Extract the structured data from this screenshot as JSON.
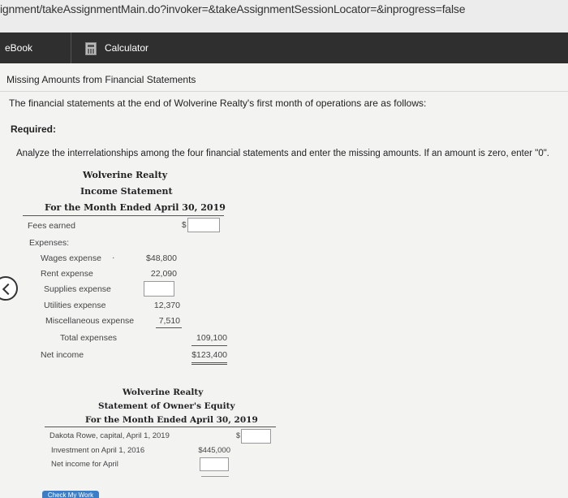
{
  "browser": {
    "url": "ignment/takeAssignmentMain.do?invoker=&takeAssignmentSessionLocator=&inprogress=false"
  },
  "toolbar": {
    "ebook_label": "eBook",
    "calculator_label": "Calculator",
    "calculator_icon": "calculator-icon"
  },
  "problem": {
    "title": "Missing Amounts from Financial Statements",
    "intro": "The financial statements at the end of Wolverine Realty's first month of operations are as follows:",
    "required_label": "Required:",
    "instruction": "Analyze the interrelationships among the four financial statements and enter the missing amounts. If an amount is zero, enter \"0\"."
  },
  "income_statement": {
    "company": "Wolverine Realty",
    "statement": "Income Statement",
    "period": "For the Month Ended April 30, 2019",
    "fees_earned_label": "Fees earned",
    "fees_earned_value": "",
    "currency_symbol": "$",
    "expenses_label": "Expenses:",
    "expenses": [
      {
        "label": "Wages expense",
        "value": "$48,800"
      },
      {
        "label": "Rent expense",
        "value": "22,090"
      },
      {
        "label": "Supplies expense",
        "value": ""
      },
      {
        "label": "Utilities expense",
        "value": "12,370"
      },
      {
        "label": "Miscellaneous expense",
        "value": "7,510"
      }
    ],
    "total_expenses_label": "Total expenses",
    "total_expenses_value": "109,100",
    "net_income_label": "Net income",
    "net_income_value": "$123,400"
  },
  "owners_equity": {
    "company": "Wolverine Realty",
    "statement": "Statement of Owner's Equity",
    "period": "For the Month Ended April 30, 2019",
    "capital_label": "Dakota Rowe, capital, April 1, 2019",
    "capital_value": "",
    "currency_symbol": "$",
    "investment_label": "Investment on April 1, 2016",
    "investment_value": "$445,000",
    "net_income_label": "Net income for April",
    "net_income_value": ""
  },
  "footer": {
    "check_button_label": "Check My Work"
  }
}
